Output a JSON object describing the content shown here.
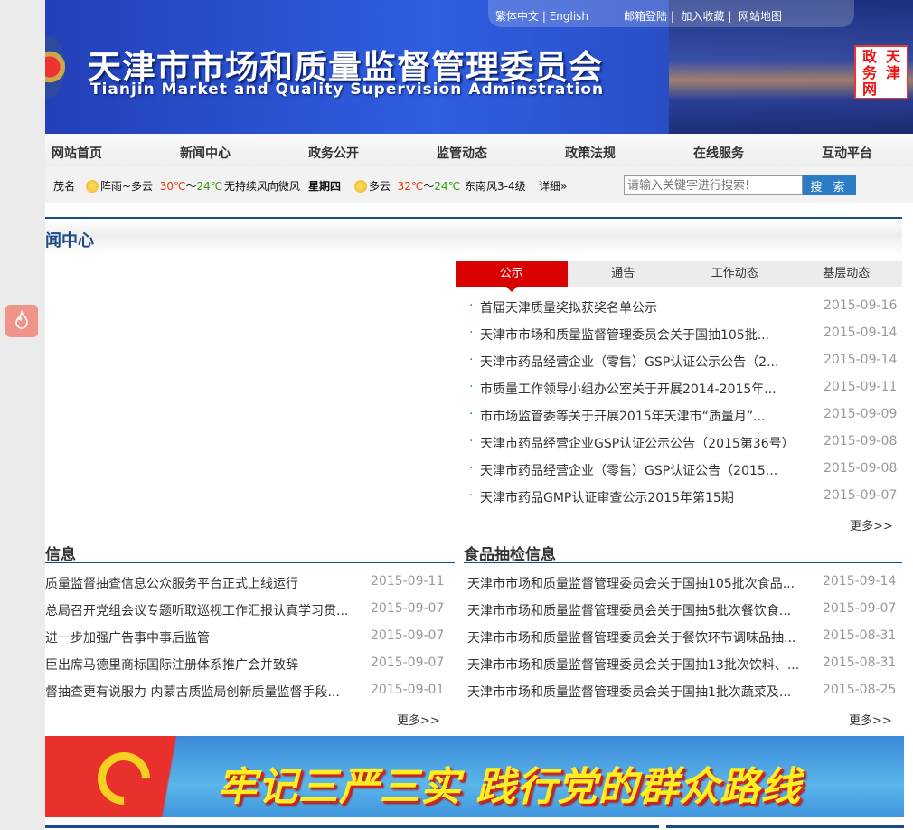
{
  "header": {
    "lang_links": [
      "繁体中文",
      "English"
    ],
    "util_links": [
      "邮箱登陆",
      "加入收藏",
      "网站地图"
    ],
    "title_cn": "天津市市场和质量监督管理委员会",
    "title_en": "Tianjin Market and Quality Supervision Adminstration",
    "seal_text": [
      "天",
      "政",
      "津",
      "务",
      "",
      "网"
    ]
  },
  "nav": [
    "网站首页",
    "新闻中心",
    "政务公开",
    "监管动态",
    "政策法规",
    "在线服务",
    "互动平台"
  ],
  "weather": {
    "city": "茂名",
    "today_cond": "阵雨~多云",
    "today_high": "30℃",
    "today_sep": "～",
    "today_low": "24℃",
    "today_wind": "无持续风向微风",
    "weekday": "星期四",
    "tomorrow_cond": "多云",
    "tomorrow_high": "32℃",
    "tomorrow_low": "24℃",
    "tomorrow_wind": "东南风3-4级",
    "detail": "详细»"
  },
  "search": {
    "placeholder": "请输入关键字进行搜索!",
    "button": "搜 索"
  },
  "news_center": {
    "title": "闻中心",
    "tabs": [
      "公示",
      "通告",
      "工作动态",
      "基层动态"
    ],
    "items": [
      {
        "title": "首届天津质量奖拟获奖名单公示",
        "date": "2015-09-16"
      },
      {
        "title": "天津市市场和质量监督管理委员会关于国抽105批...",
        "date": "2015-09-14"
      },
      {
        "title": "天津市药品经营企业（零售）GSP认证公示公告（2...",
        "date": "2015-09-14"
      },
      {
        "title": "市质量工作领导小组办公室关于开展2014-2015年...",
        "date": "2015-09-11"
      },
      {
        "title": "市市场监管委等关于开展2015年天津市“质量月”...",
        "date": "2015-09-09"
      },
      {
        "title": "天津市药品经营企业GSP认证公示公告（2015第36号）",
        "date": "2015-09-08"
      },
      {
        "title": "天津市药品经营企业（零售）GSP认证公告（2015...",
        "date": "2015-09-08"
      },
      {
        "title": "天津市药品GMP认证审查公示2015年第15期",
        "date": "2015-09-07"
      }
    ],
    "more": "更多>>"
  },
  "left_section": {
    "title": "信息",
    "items": [
      {
        "title": "质量监督抽查信息公众服务平台正式上线运行",
        "date": "2015-09-11"
      },
      {
        "title": "总局召开党组会议专题听取巡视工作汇报认真学习贯...",
        "date": "2015-09-07"
      },
      {
        "title": "进一步加强广告事中事后监管",
        "date": "2015-09-07"
      },
      {
        "title": "臣出席马德里商标国际注册体系推广会并致辞",
        "date": "2015-09-07"
      },
      {
        "title": "督抽查更有说服力 内蒙古质监局创新质量监督手段...",
        "date": "2015-09-01"
      }
    ],
    "more": "更多>>"
  },
  "food_section": {
    "title": "食品抽检信息",
    "items": [
      {
        "title": "天津市市场和质量监督管理委员会关于国抽105批次食品...",
        "date": "2015-09-14"
      },
      {
        "title": "天津市市场和质量监督管理委员会关于国抽5批次餐饮食...",
        "date": "2015-09-07"
      },
      {
        "title": "天津市市场和质量监督管理委员会关于餐饮环节调味品抽...",
        "date": "2015-08-31"
      },
      {
        "title": "天津市市场和质量监督管理委员会关于国抽13批次饮料、...",
        "date": "2015-08-31"
      },
      {
        "title": "天津市市场和质量监督管理委员会关于国抽1批次蔬菜及...",
        "date": "2015-08-25"
      }
    ],
    "more": "更多>>"
  },
  "banner": {
    "text": "牢记三严三实  践行党的群众路线"
  },
  "colors": {
    "brand_blue": "#1a4a8a",
    "tab_red": "#d90000",
    "search_blue": "#2b7cc4"
  }
}
